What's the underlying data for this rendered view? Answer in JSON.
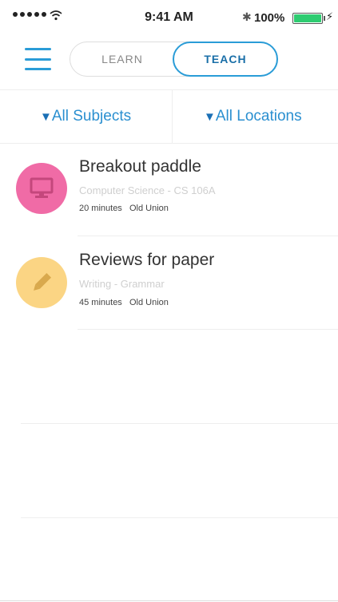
{
  "status_bar": {
    "time": "9:41 AM",
    "battery_percent": "100%",
    "battery_level": 1.0,
    "signal_bars": 5,
    "icons": [
      "signal-dots-icon",
      "wifi-icon",
      "bluetooth-icon",
      "battery-icon",
      "charging-icon"
    ]
  },
  "header": {
    "menu_icon": "hamburger-menu-icon",
    "toggle": {
      "learn_label": "LEARN",
      "teach_label": "TEACH",
      "selected": "TEACH"
    }
  },
  "filters": {
    "subjects_label": "All Subjects",
    "locations_label": "All Locations",
    "dropdown_icon": "triangle-down-icon"
  },
  "sessions": [
    {
      "title": "Breakout paddle",
      "subject": "Computer Science - CS 106A",
      "duration": "20 minutes",
      "location": "Old Union",
      "icon": "monitor-icon",
      "color": "#f06ba6"
    },
    {
      "title": "Reviews for paper",
      "subject": "Writing - Grammar",
      "duration": "45 minutes",
      "location": "Old Union",
      "icon": "pencil-icon",
      "color": "#fbd584"
    }
  ],
  "colors": {
    "accent": "#2a9cd7",
    "battery": "#2ecc71"
  }
}
